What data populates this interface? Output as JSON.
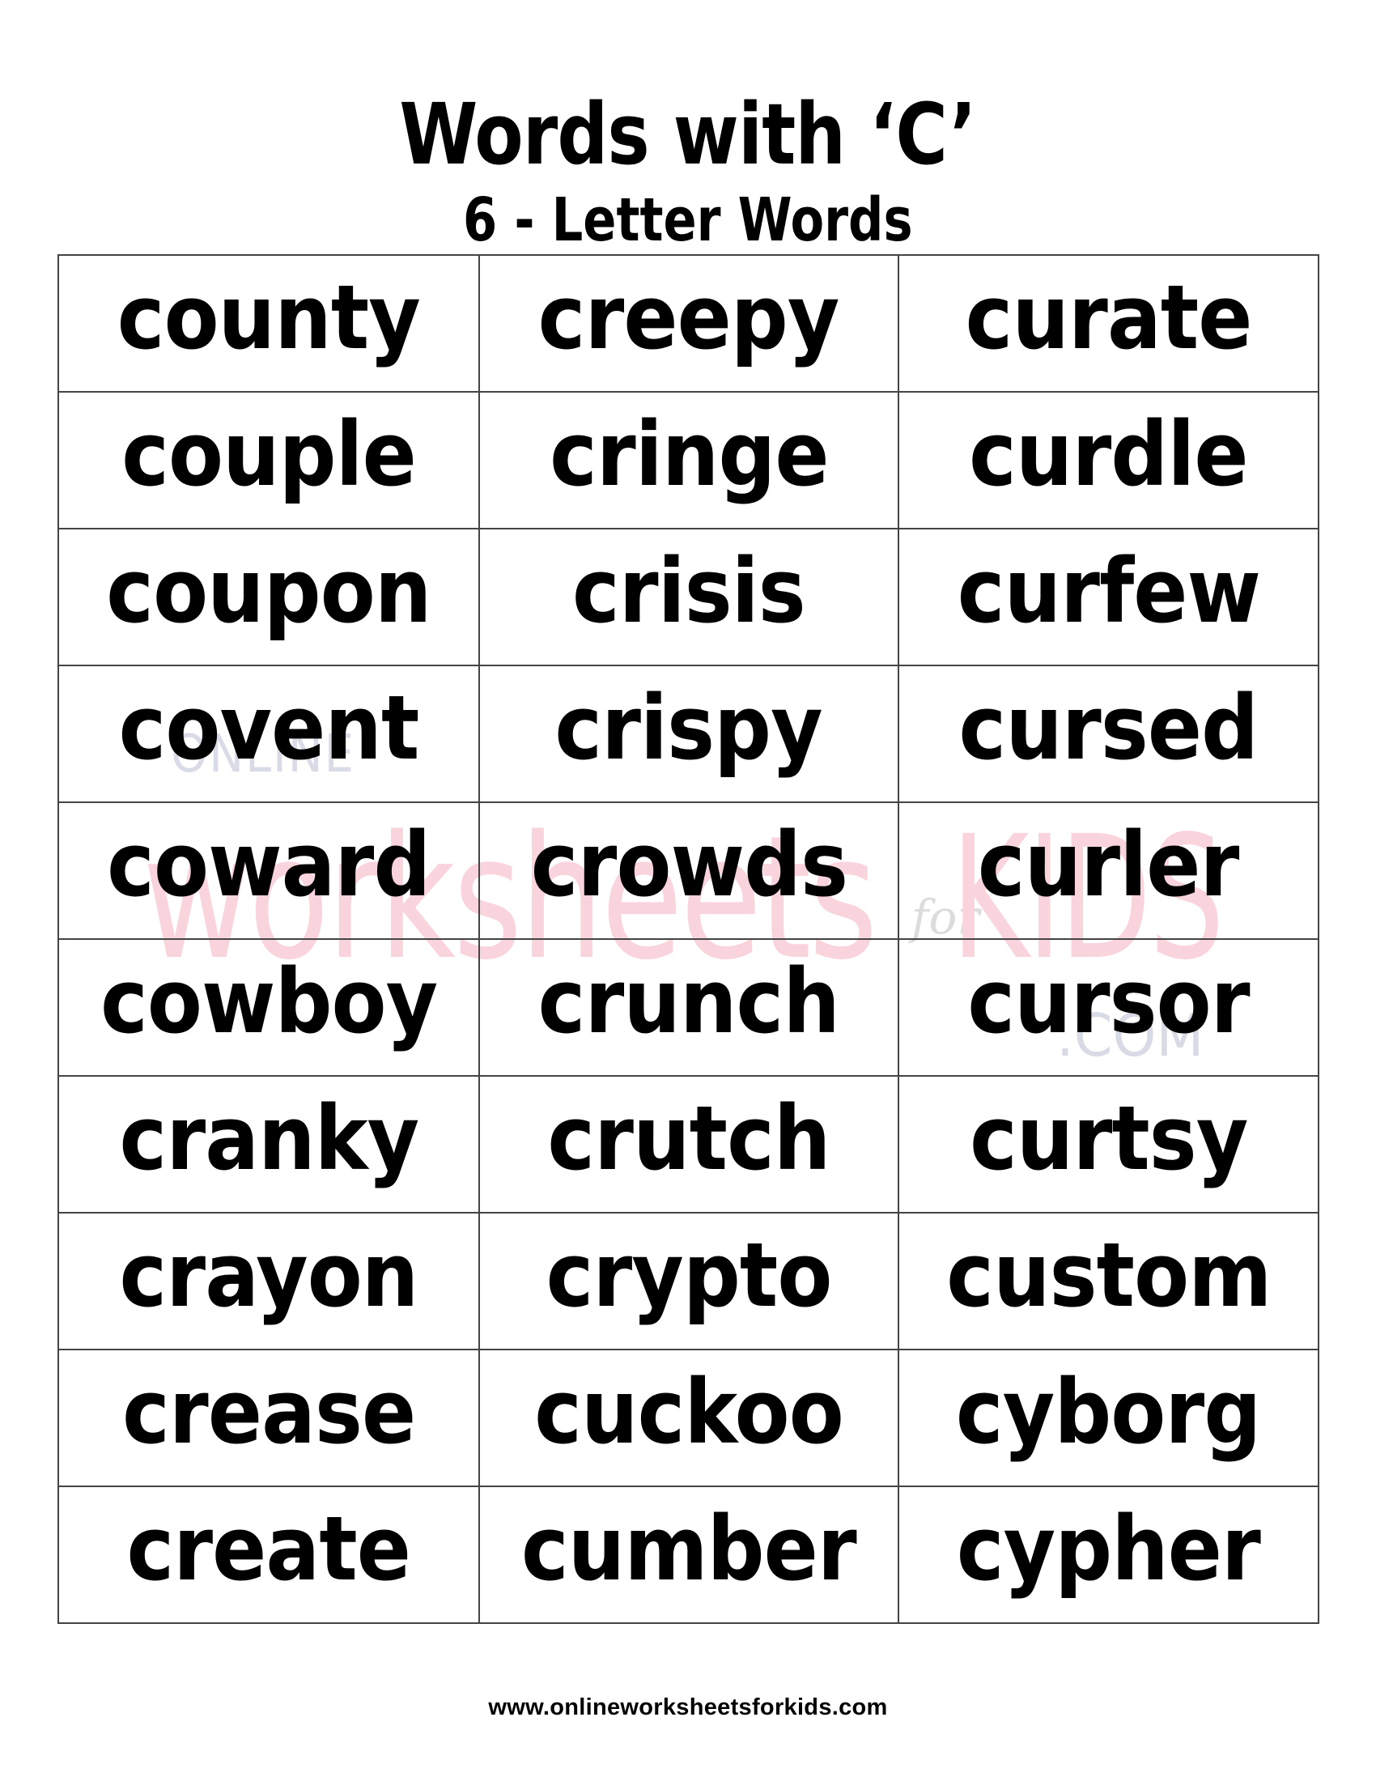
{
  "header": {
    "title": "Words with ‘C’",
    "subtitle": "6 - Letter Words"
  },
  "watermark": {
    "online": "ONLINE",
    "worksheets": "worksheets",
    "for": "for",
    "kids": "KIDS",
    "com": ".COM",
    "colors": {
      "pink": "#fad4dc",
      "grayblue": "#d8dae6"
    }
  },
  "table": {
    "rows": [
      [
        "county",
        "creepy",
        "curate"
      ],
      [
        "couple",
        "cringe",
        "curdle"
      ],
      [
        "coupon",
        "crisis",
        "curfew"
      ],
      [
        "covent",
        "crispy",
        "cursed"
      ],
      [
        "coward",
        "crowds",
        "curler"
      ],
      [
        "cowboy",
        "crunch",
        "cursor"
      ],
      [
        "cranky",
        "crutch",
        "curtsy"
      ],
      [
        "crayon",
        "crypto",
        "custom"
      ],
      [
        "crease",
        "cuckoo",
        "cyborg"
      ],
      [
        "create",
        "cumber",
        "cypher"
      ]
    ]
  },
  "footer": {
    "url": "www.onlineworksheetsforkids.com"
  }
}
